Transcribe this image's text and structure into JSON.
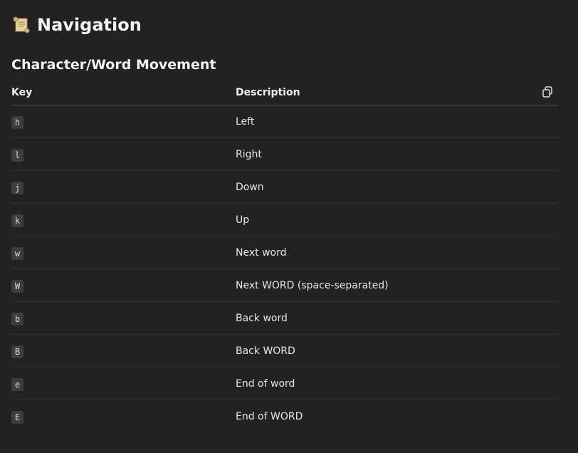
{
  "page": {
    "title": "Navigation",
    "title_icon": "scroll-icon"
  },
  "section": {
    "title": "Character/Word Movement"
  },
  "table": {
    "headers": {
      "key": "Key",
      "description": "Description"
    },
    "copy_icon": "copy-icon",
    "rows": [
      {
        "key": "h",
        "description": "Left"
      },
      {
        "key": "l",
        "description": "Right"
      },
      {
        "key": "j",
        "description": "Down"
      },
      {
        "key": "k",
        "description": "Up"
      },
      {
        "key": "w",
        "description": "Next word"
      },
      {
        "key": "W",
        "description": "Next WORD (space-separated)"
      },
      {
        "key": "b",
        "description": "Back word"
      },
      {
        "key": "B",
        "description": "Back WORD"
      },
      {
        "key": "e",
        "description": "End of word"
      },
      {
        "key": "E",
        "description": "End of WORD"
      }
    ]
  },
  "colors": {
    "background": "#222222",
    "text": "#e6e6e6",
    "key_badge_bg": "#3d3d3d",
    "header_rule": "#5a5a5a",
    "row_rule": "#333333"
  }
}
